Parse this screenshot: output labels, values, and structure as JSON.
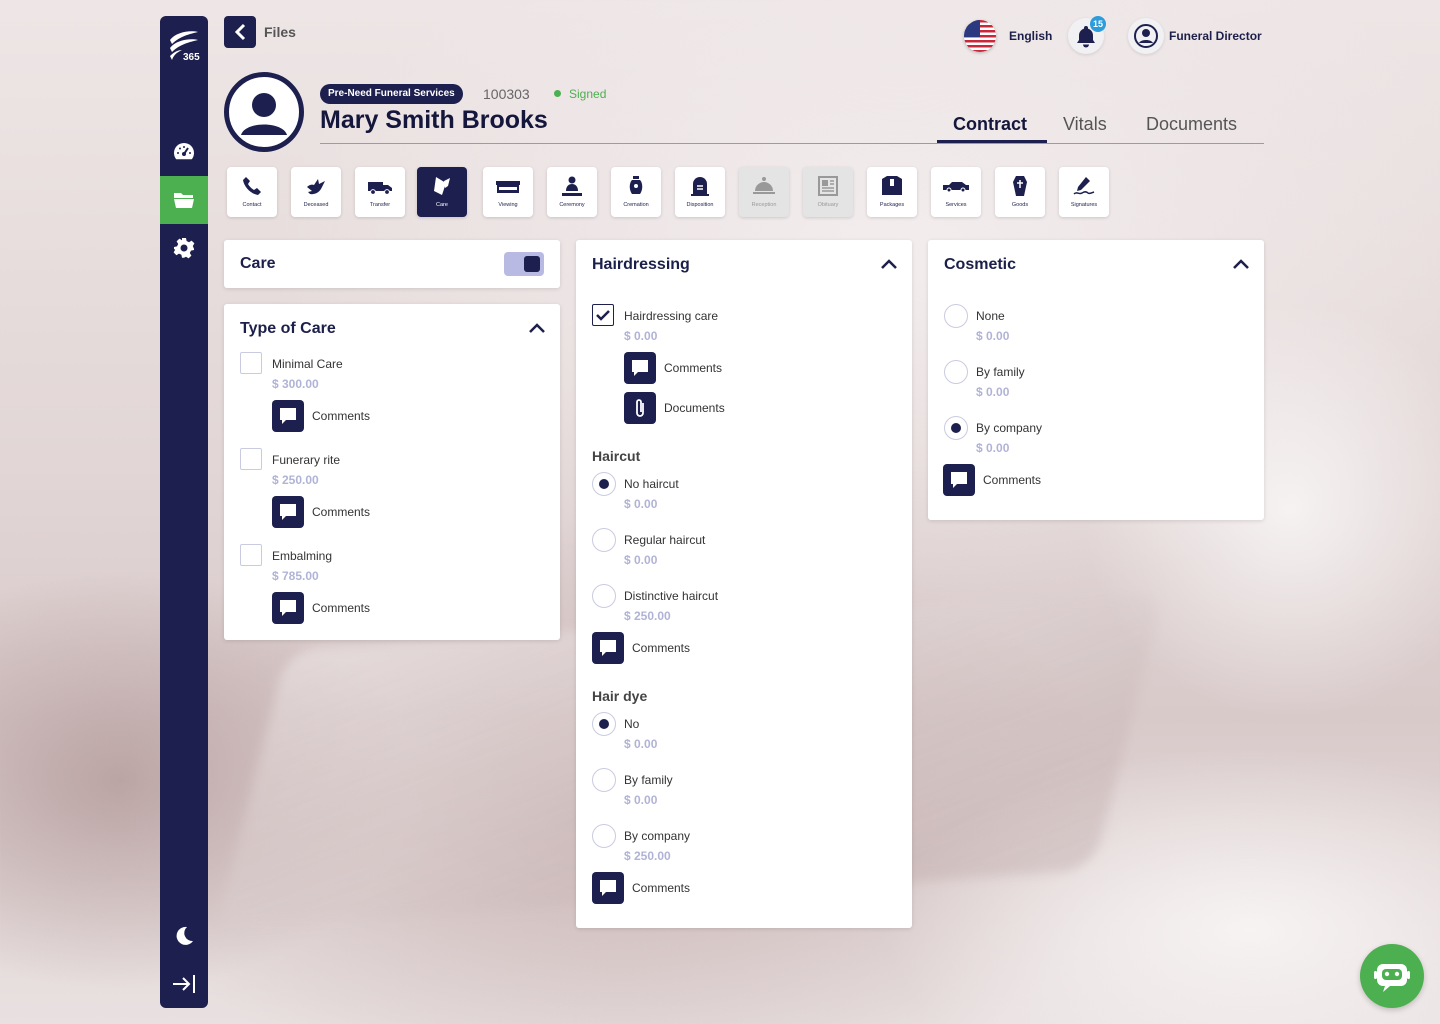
{
  "header": {
    "back_label": "Files",
    "language": "English",
    "notifications_count": "15",
    "user_role": "Funeral Director"
  },
  "profile": {
    "service_type": "Pre-Need Funeral Services",
    "file_number": "100303",
    "status": "Signed",
    "name": "Mary Smith Brooks"
  },
  "tabs": [
    {
      "label": "Contract",
      "active": true
    },
    {
      "label": "Vitals",
      "active": false
    },
    {
      "label": "Documents",
      "active": false
    }
  ],
  "sections": [
    {
      "label": "Contact",
      "icon": "phone-icon",
      "state": "normal"
    },
    {
      "label": "Deceased",
      "icon": "dove-icon",
      "state": "normal"
    },
    {
      "label": "Transfer",
      "icon": "van-icon",
      "state": "normal"
    },
    {
      "label": "Care",
      "icon": "comb-icon",
      "state": "active"
    },
    {
      "label": "Viewing",
      "icon": "casket-icon",
      "state": "normal"
    },
    {
      "label": "Ceremony",
      "icon": "ceremony-icon",
      "state": "normal"
    },
    {
      "label": "Cremation",
      "icon": "urn-icon",
      "state": "normal"
    },
    {
      "label": "Disposition",
      "icon": "headstone-icon",
      "state": "normal"
    },
    {
      "label": "Reception",
      "icon": "cloche-icon",
      "state": "disabled"
    },
    {
      "label": "Obituary",
      "icon": "newspaper-icon",
      "state": "disabled"
    },
    {
      "label": "Packages",
      "icon": "package-icon",
      "state": "normal"
    },
    {
      "label": "Services",
      "icon": "hearse-icon",
      "state": "normal"
    },
    {
      "label": "Goods",
      "icon": "coffin-icon",
      "state": "normal"
    },
    {
      "label": "Signatures",
      "icon": "signature-icon",
      "state": "normal"
    }
  ],
  "care_card": {
    "title": "Care",
    "toggle_on": true
  },
  "type_of_care": {
    "title": "Type of Care",
    "options": [
      {
        "label": "Minimal Care",
        "price": "$ 300.00",
        "checked": false
      },
      {
        "label": "Funerary rite",
        "price": "$ 250.00",
        "checked": false
      },
      {
        "label": "Embalming",
        "price": "$ 785.00",
        "checked": false
      }
    ],
    "comments_label": "Comments"
  },
  "hairdressing": {
    "title": "Hairdressing",
    "care_option": {
      "label": "Hairdressing care",
      "price": "$ 0.00",
      "checked": true
    },
    "comments_label": "Comments",
    "documents_label": "Documents",
    "haircut": {
      "title": "Haircut",
      "options": [
        {
          "label": "No haircut",
          "price": "$ 0.00",
          "selected": true
        },
        {
          "label": "Regular haircut",
          "price": "$ 0.00",
          "selected": false
        },
        {
          "label": "Distinctive haircut",
          "price": "$ 250.00",
          "selected": false
        }
      ]
    },
    "hair_dye": {
      "title": "Hair dye",
      "options": [
        {
          "label": "No",
          "price": "$ 0.00",
          "selected": true
        },
        {
          "label": "By family",
          "price": "$ 0.00",
          "selected": false
        },
        {
          "label": "By company",
          "price": "$ 250.00",
          "selected": false
        }
      ]
    }
  },
  "cosmetic": {
    "title": "Cosmetic",
    "options": [
      {
        "label": "None",
        "price": "$ 0.00",
        "selected": false
      },
      {
        "label": "By family",
        "price": "$ 0.00",
        "selected": false
      },
      {
        "label": "By company",
        "price": "$ 0.00",
        "selected": true
      }
    ],
    "comments_label": "Comments"
  },
  "colors": {
    "navy": "#1d1f4e",
    "green": "#4caf50",
    "price": "#b1b3d6",
    "badge": "#2d9cdb"
  }
}
